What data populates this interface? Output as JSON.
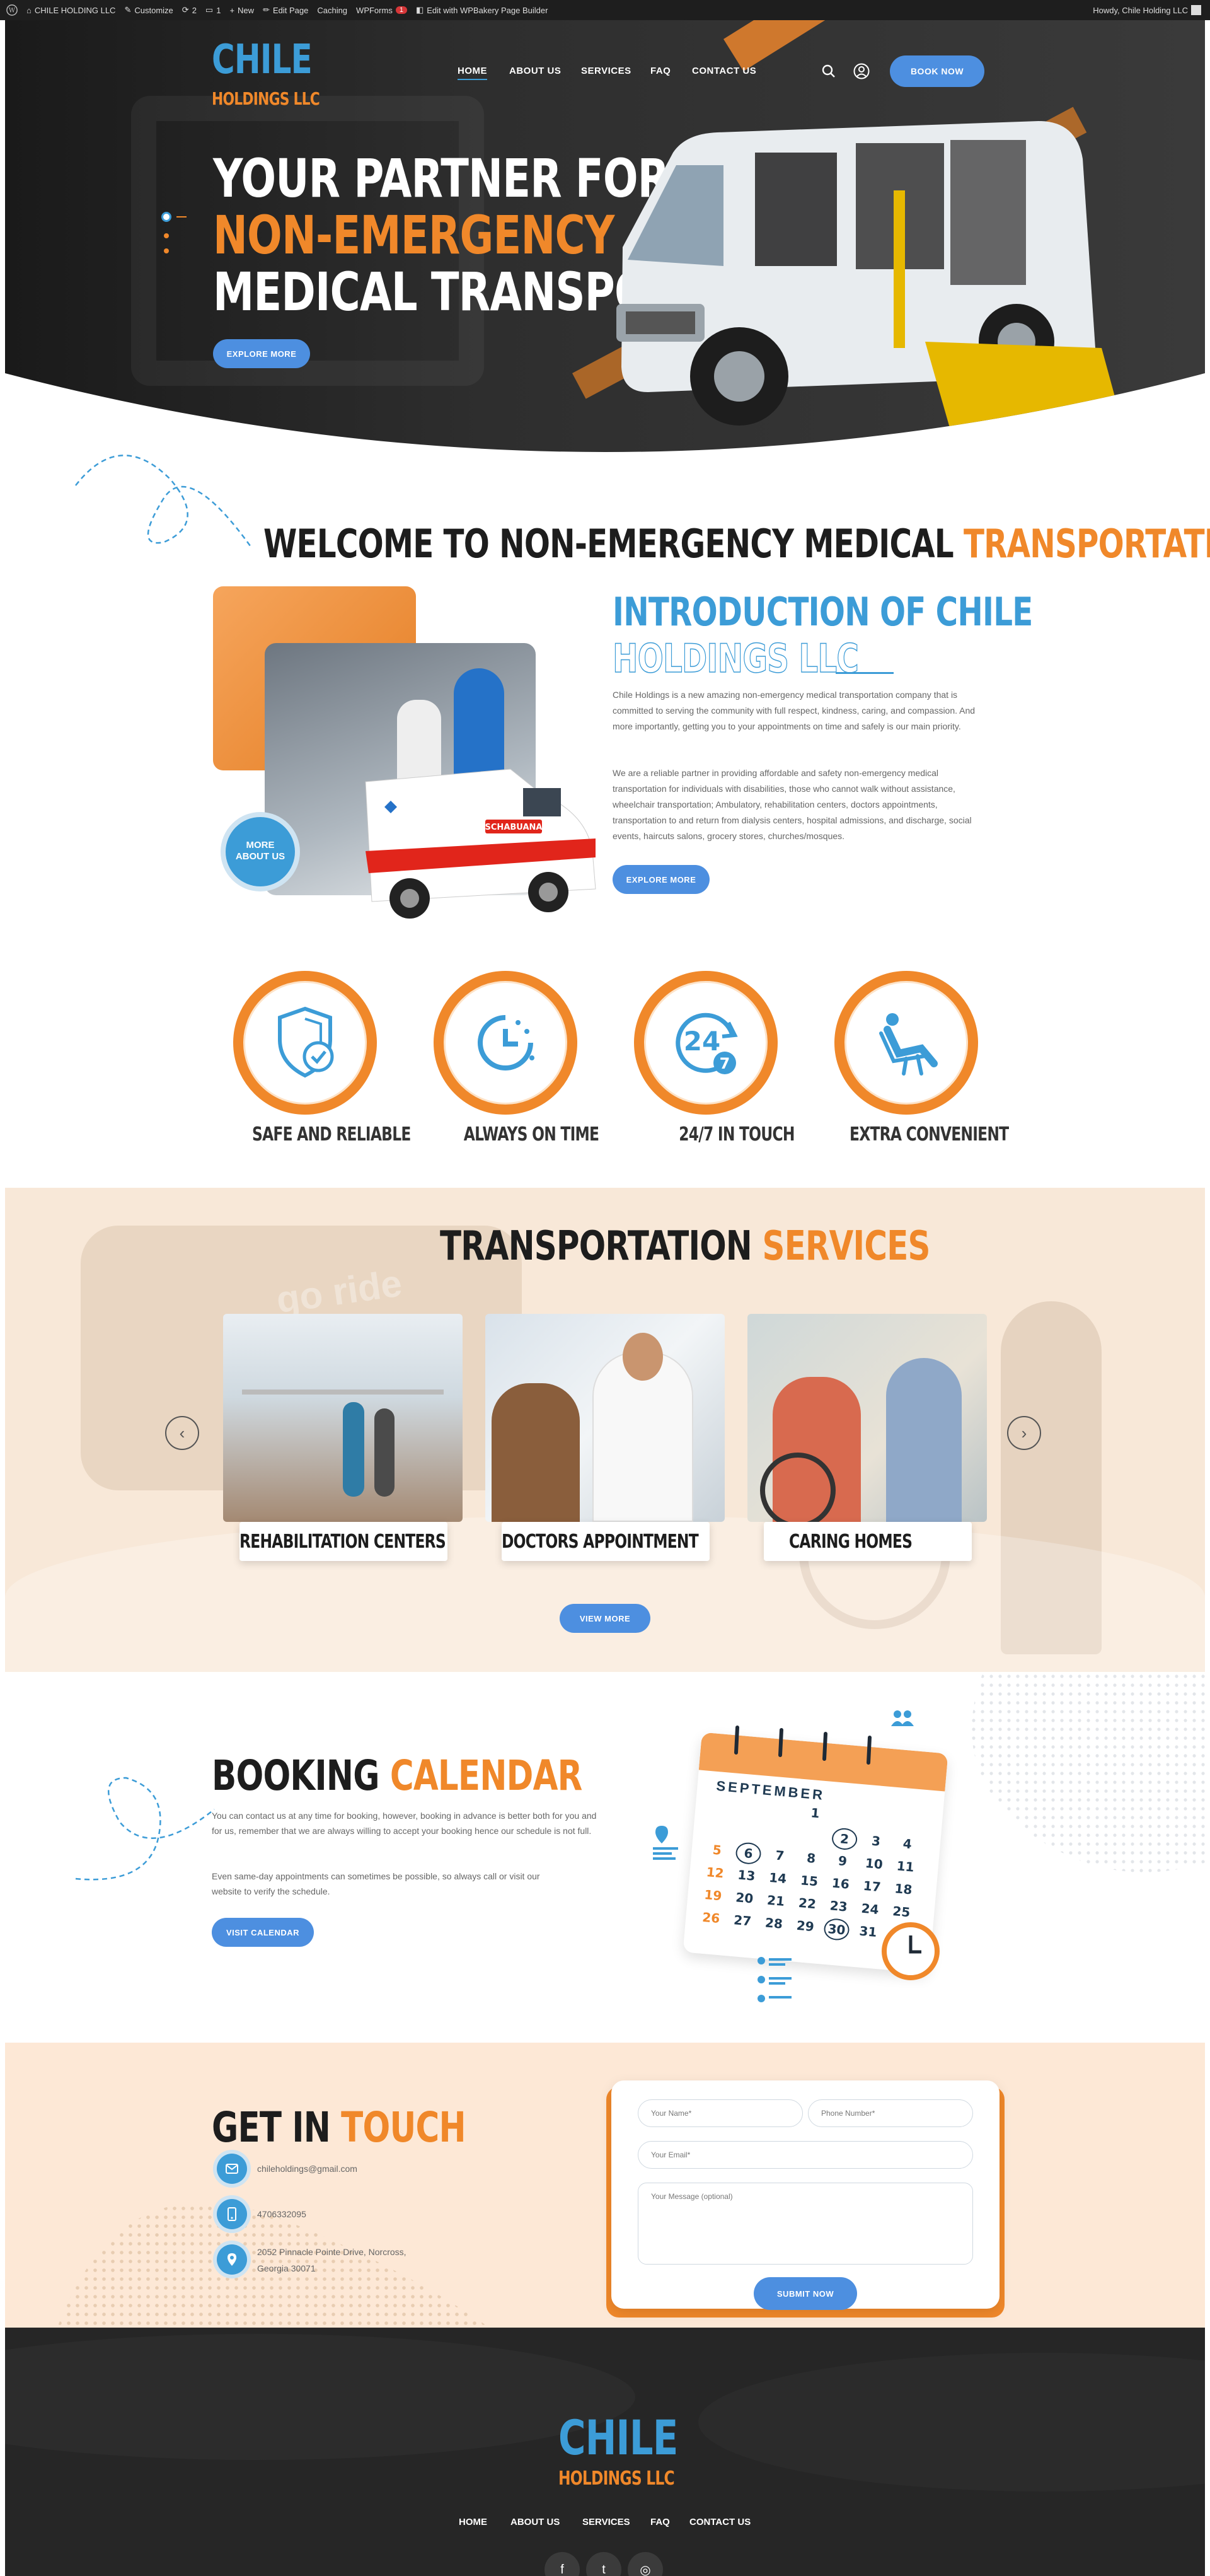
{
  "adminbar": {
    "site": "CHILE HOLDING LLC",
    "customize": "Customize",
    "revisions": "2",
    "comments": "1",
    "new": "New",
    "edit_page": "Edit Page",
    "caching": "Caching",
    "wpforms": "WPForms",
    "wpforms_badge": "1",
    "wpbakery": "Edit with WPBakery Page Builder",
    "howdy": "Howdy, Chile Holding LLC"
  },
  "header": {
    "logo_top": "CHILE",
    "logo_bottom": "HOLDINGS LLC",
    "nav": [
      "HOME",
      "ABOUT US",
      "SERVICES",
      "FAQ",
      "CONTACT US"
    ],
    "book_now": "BOOK NOW"
  },
  "hero": {
    "line1": "YOUR PARTNER FOR",
    "line2": "NON-EMERGENCY",
    "line3": "MEDICAL TRANSPORT",
    "button": "EXPLORE MORE"
  },
  "welcome": {
    "title_a": "WELCOME TO NON-EMERGENCY MEDICAL",
    "title_b": "TRANSPORTATION",
    "intro_title_1": "INTRODUCTION OF CHILE",
    "intro_title_2": "HOLDINGS LLC",
    "para1": "Chile Holdings is a new amazing non-emergency medical transportation company that is committed to serving the community with full respect, kindness, caring, and compassion. And more importantly, getting you to your appointments on time and safely is our main priority.",
    "para2": "We are a reliable partner in providing affordable and safety non-emergency medical transportation for individuals with disabilities, those who cannot walk without assistance, wheelchair transportation; Ambulatory, rehabilitation centers, doctors appointments, transportation to and return from dialysis centers, hospital admissions, and discharge, social events, haircuts salons, grocery stores, churches/mosques.",
    "button": "EXPLORE MORE",
    "more_about_1": "MORE",
    "more_about_2": "ABOUT US",
    "ambulance_text": "SCHABUANA"
  },
  "features": [
    {
      "label": "SAFE AND RELIABLE",
      "icon": "shield-check-icon"
    },
    {
      "label": "ALWAYS ON TIME",
      "icon": "clock-icon"
    },
    {
      "label": "24/7 IN TOUCH",
      "icon": "24-7-icon"
    },
    {
      "label": "EXTRA CONVENIENT",
      "icon": "recliner-seat-icon"
    }
  ],
  "services": {
    "title_a": "TRANSPORTATION",
    "title_b": "SERVICES",
    "cards": [
      "REHABILITATION CENTERS",
      "DOCTORS APPOINTMENT",
      "CARING HOMES"
    ],
    "button": "VIEW MORE",
    "prev": "‹",
    "next": "›",
    "bg_van_text": "go ride"
  },
  "booking": {
    "title_a": "BOOKING",
    "title_b": "CALENDAR",
    "para1": "You can contact us at any time for booking, however, booking in advance is better both for you and for us, remember that we are always willing to accept your booking hence our schedule is not full.",
    "para2": "Even same-day appointments can sometimes be possible, so always call or visit our website to verify the schedule.",
    "button": "VISIT CALENDAR",
    "month": "SEPTEMBER",
    "days": [
      [
        "",
        "",
        "",
        "1",
        "",
        "",
        ""
      ],
      [
        "",
        "",
        "",
        "",
        "2",
        "3",
        "4"
      ],
      [
        "5",
        "6",
        "7",
        "8",
        "9",
        "10",
        "11"
      ],
      [
        "12",
        "13",
        "14",
        "15",
        "16",
        "17",
        "18"
      ],
      [
        "19",
        "20",
        "21",
        "22",
        "23",
        "24",
        "25"
      ],
      [
        "26",
        "27",
        "28",
        "29",
        "30",
        "31",
        ""
      ]
    ]
  },
  "contact": {
    "title_a": "GET IN",
    "title_b": "TOUCH",
    "email": "chileholdings@gmail.com",
    "phone": "4706332095",
    "address_1": "2052 Pinnacle Pointe Drive, Norcross,",
    "address_2": "Georgia 30071",
    "name_ph": "Your Name*",
    "phone_ph": "Phone Number*",
    "email_ph": "Your Email*",
    "message_ph": "Your Message (optional)",
    "submit": "SUBMIT NOW"
  },
  "footer": {
    "logo_top": "CHILE",
    "logo_bottom": "HOLDINGS LLC",
    "nav": [
      "HOME",
      "ABOUT US",
      "SERVICES",
      "FAQ",
      "CONTACT US"
    ],
    "social": [
      "facebook-icon",
      "twitter-icon",
      "instagram-icon"
    ],
    "social_glyphs": [
      "f",
      "t",
      "◎"
    ]
  },
  "colors": {
    "orange": "#f0882a",
    "blue": "#3c9cd7",
    "button_blue": "#4d8fe0",
    "dark": "#262626",
    "peach": "#fde8d6"
  }
}
